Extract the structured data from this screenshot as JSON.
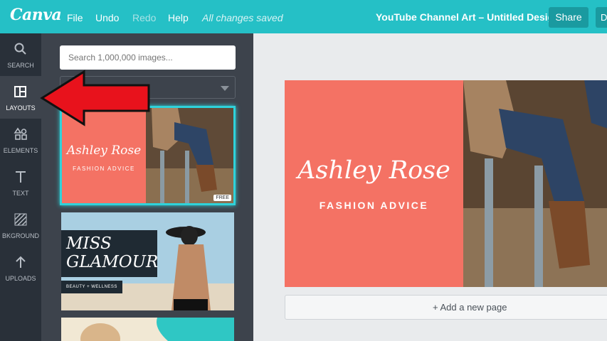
{
  "topbar": {
    "logo": "Canva",
    "menu": {
      "file": "File",
      "undo": "Undo",
      "redo": "Redo",
      "help": "Help"
    },
    "status": "All changes saved",
    "doc_title": "YouTube Channel Art – Untitled Design",
    "share_label": "Share",
    "extra_label": "D"
  },
  "sidebar": {
    "items": [
      {
        "label": "SEARCH",
        "icon": "search-icon"
      },
      {
        "label": "LAYOUTS",
        "icon": "layouts-icon"
      },
      {
        "label": "ELEMENTS",
        "icon": "elements-icon"
      },
      {
        "label": "TEXT",
        "icon": "text-icon"
      },
      {
        "label": "BKGROUND",
        "icon": "background-icon"
      },
      {
        "label": "UPLOADS",
        "icon": "uploads-icon"
      }
    ],
    "active": "LAYOUTS"
  },
  "panel": {
    "search_placeholder": "Search 1,000,000 images...",
    "layouts": [
      {
        "title": "Ashley Rose",
        "subtitle": "FASHION ADVICE",
        "badge": "FREE"
      },
      {
        "title_line1": "MISS",
        "title_line2": "GLAMOUR",
        "tagline": "BEAUTY + WELLNESS"
      }
    ]
  },
  "canvas": {
    "title": "Ashley Rose",
    "subtitle": "FASHION ADVICE",
    "add_page_label": "+ Add a new page"
  },
  "colors": {
    "brand": "#25c0c6",
    "coral": "#f47264",
    "sidebar": "#293039",
    "panel": "#3d434c",
    "annotation_arrow": "#e8121c"
  },
  "annotation": {
    "type": "arrow",
    "points_to": "LAYOUTS"
  }
}
